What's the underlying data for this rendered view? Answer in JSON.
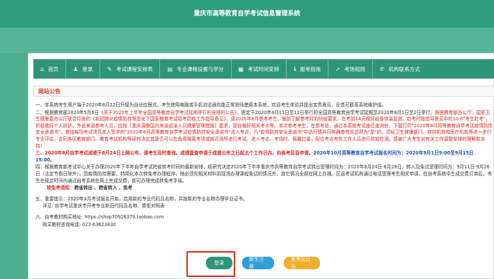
{
  "header": {
    "title": "重庆市高等教育自学考试信息管理系统"
  },
  "nav": [
    {
      "icon": "home-icon",
      "glyph": "⌂",
      "label": "首页"
    },
    {
      "icon": "user-icon",
      "glyph": "♟",
      "label": "登录"
    },
    {
      "icon": "tag-icon",
      "glyph": "✎",
      "label": "考试课程安排表"
    },
    {
      "icon": "book-icon",
      "glyph": "▤",
      "label": "专业课程设置与学分"
    },
    {
      "icon": "calendar-icon",
      "glyph": "▦",
      "label": "考试时间安排"
    },
    {
      "icon": "info-icon",
      "glyph": "ℹ",
      "label": "报考指南"
    },
    {
      "icon": "rocket-icon",
      "glyph": "➚",
      "label": "考场规则"
    },
    {
      "icon": "phone-icon",
      "glyph": "✆",
      "label": "机构联系方式"
    }
  ],
  "section_title": "网站公告",
  "notice": {
    "p1": "一、本系统考生用户端于2020年8月22日升级为自适应模式，考生使用电脑或手机浏览器均能正常登陆使用本系统，欢迎考生体验并提出宝贵意见，反馈可联系系统维护组。",
    "p2_a": "二、根据教育部2020年5月6日",
    "p2_b": "《关于2020年上半年全国高等教育自学考试延期举行的安排的公告》",
    "p2_c": "，鹿定于2020年4月11日至12日举行的全国高等教育自学考试延期至2020年8月1日至2日举行。",
    "p2_d": "根据教育部办公厅、国家卫生健康委办公厅联合印发的《新冠肺炎疫情防控常态化下国家教育考试组考防疫工作指导意见》，请2020年8月参考考生，按前了解参考时的防疫要求，在考前14天做好自身体温监测，赴考时按指导意见中的10.6\"考生赴考\"，积极做好个人防护。外省来渝参考人员，应按《重庆调整国内来渝返渝人员健康管理措施》要求，提前做好相关考点等。本次参考考生，在参考前，通过本系统考试座位查询处，下载打印\"2020年8月高等教育自学考试疫情防控安全承诺书\"。参加每场考试须凭本人签字的\"2020年8月高等教育自学考试疫情防控安全承诺书\"进入考点，凡\"疫情防控安全承诺书\"中选行情异同各确查有关选项为\"是\"的，须经卫生健康部门、疾控机构和医疗机构等进一步行专业评估，会同各区教育部门、教育考试机构等研判决定其是否可以在备用隔离考场或就近场所进行考试。进入考点、考场时，佩戴口罩，配合考点考务工作人员进行防疫检测。感谢广大考生对有关工作调整安排的理解和支持！",
    "p3_a": "三、2020年8月自学考试成绩于8月24日上网公布，请考生及时查询。成绩复查申请于成绩公布之日起五个工作日内，向各考区县申请。",
    "p3_b": "2020年10月高等教育自学考试报名时间为：2020年9月1日9:00至9月15日15:00。",
    "p4": "四、根据教育部考试中心关于办理2020年下半年自学考试跨省转考时间的最新安排，经研究决定2020年下半年重庆市高等教育自学考试转出受理时间为：2020年8月24日-8月28日，转入及免试受理时间为：9月11日-9月26日（法定节假日除外）。因疫情防控需要，特简化本次转免考办理程序，除必须先相关材料到现场办理课程免试的情况外，其它情况全部在网上办理。区县考试机构通过电话受理考生相关申请，在自考系统中生成交费订单后，考生在规定时间内通过自考系统在网上完成交费，即可办理完成转免考手续。",
    "p4_link_label": "转免考须知：",
    "p4_links": "跨省转出 、跨省转入 、免考",
    "p5_a": "五、重要提示：2020年4月考试报名开始，启用新的专业代码及名称，并按新的专业名称办理毕业证书。",
    "p5_b": "详见: 自学考试重庆市开考专业新旧代码及名称、类型对照表",
    "p6_a": "六、自考教材购买地址: https://shop70926379.taobao.com",
    "p6_b": "购买教材咨询电话:  023-63623830"
  },
  "buttons": {
    "login": "登录",
    "register": "新生注册",
    "district_notice": "各考区公告"
  },
  "colors": {
    "brand": "#2e9677",
    "accent_red": "#d6281c",
    "accent_blue": "#1d57b8",
    "highlight": "#e02a1a"
  }
}
